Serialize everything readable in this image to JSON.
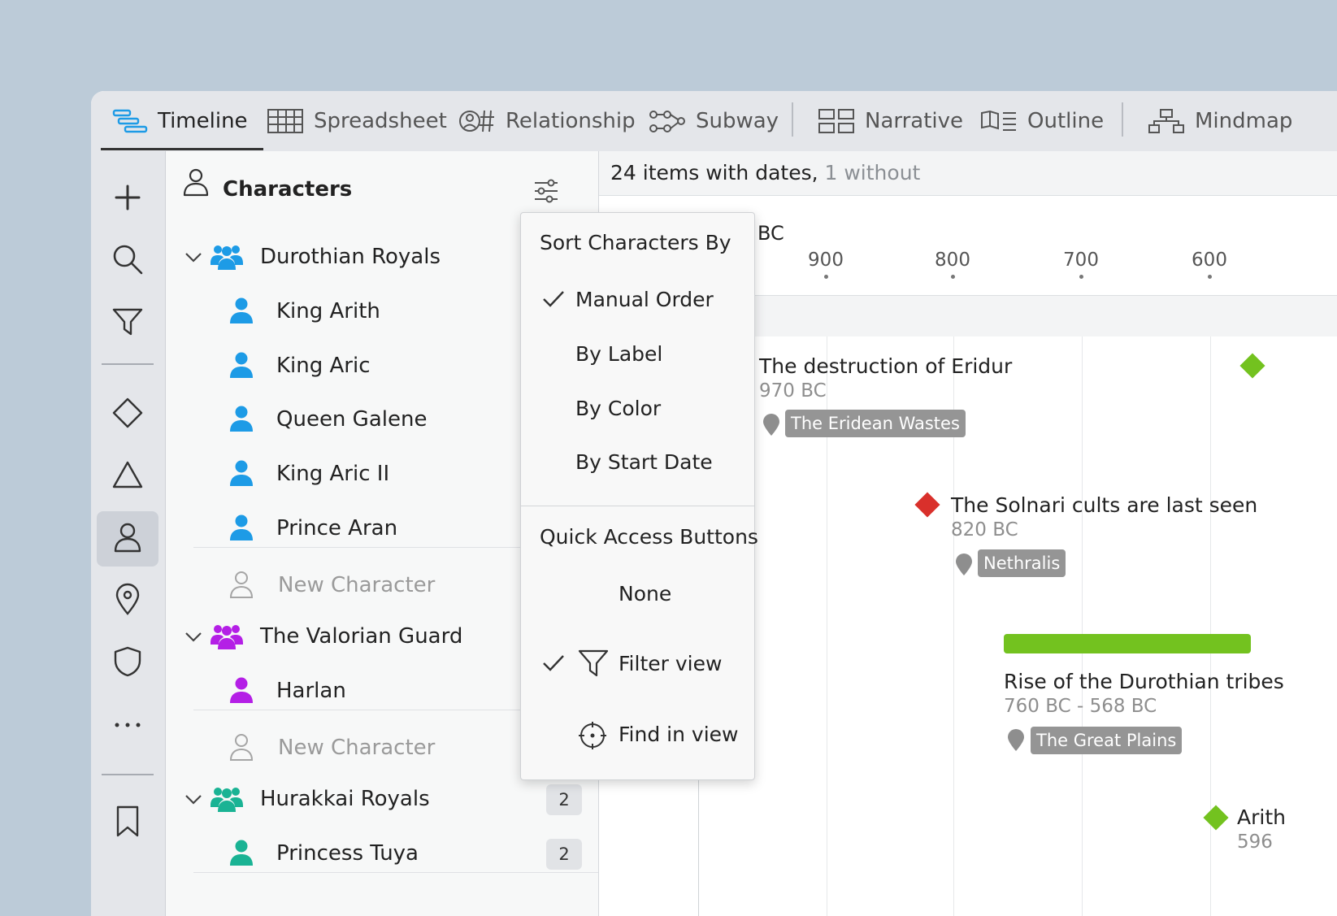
{
  "tabs": [
    {
      "label": "Timeline",
      "icon": "timeline-icon",
      "active": true
    },
    {
      "label": "Spreadsheet",
      "icon": "spreadsheet-icon"
    },
    {
      "label": "Relationship",
      "icon": "relationship-icon"
    },
    {
      "label": "Subway",
      "icon": "subway-icon"
    },
    {
      "label": "Narrative",
      "icon": "narrative-icon"
    },
    {
      "label": "Outline",
      "icon": "outline-icon"
    },
    {
      "label": "Mindmap",
      "icon": "mindmap-icon"
    }
  ],
  "rail": [
    "add-icon",
    "search-icon",
    "filter-icon",
    "diamond-icon",
    "triangle-icon",
    "person-icon",
    "location-pin-icon",
    "shield-icon",
    "more-icon",
    "bookmark-icon"
  ],
  "panel": {
    "title": "Characters",
    "groups": [
      {
        "label": "Durothian Royals",
        "color": "#1d9be6",
        "characters": [
          "King Arith",
          "King Aric",
          "Queen Galene",
          "King Aric II",
          "Prince Aran"
        ],
        "new_label": "New Character"
      },
      {
        "label": "The Valorian Guard",
        "color": "#b41fe6",
        "characters": [
          "Harlan"
        ],
        "new_label": "New Character"
      },
      {
        "label": "Hurakkai Royals",
        "color": "#1ab394",
        "count": "2",
        "characters": [
          {
            "name": "Princess Tuya",
            "count": "2"
          }
        ]
      }
    ]
  },
  "status": {
    "main": "24 items with dates,",
    "secondary": "1 without"
  },
  "axis": {
    "era": "BC",
    "ticks": [
      "900",
      "800",
      "700",
      "600"
    ]
  },
  "events": [
    {
      "title": "The destruction of Eridur",
      "date": "970 BC",
      "location": "The Eridean Wastes"
    },
    {
      "title": "The Solnari cults are last seen",
      "date": "820 BC",
      "location": "Nethralis",
      "color": "#d9302b"
    },
    {
      "title": "Rise of the Durothian tribes",
      "date": "760 BC - 568 BC",
      "location": "The Great Plains",
      "color": "#73c21f"
    },
    {
      "title": "Arith",
      "date": "596",
      "color": "#73c21f"
    }
  ],
  "dropdown": {
    "sort_heading": "Sort Characters By",
    "sort_options": [
      {
        "label": "Manual Order",
        "checked": true
      },
      {
        "label": "By Label",
        "checked": false
      },
      {
        "label": "By Color",
        "checked": false
      },
      {
        "label": "By Start Date",
        "checked": false
      }
    ],
    "quick_heading": "Quick Access Buttons",
    "quick_options": [
      {
        "label": "None",
        "checked": false
      },
      {
        "label": "Filter view",
        "checked": true,
        "icon": "filter-icon"
      },
      {
        "label": "Find in view",
        "checked": false,
        "icon": "crosshair-icon"
      }
    ]
  }
}
